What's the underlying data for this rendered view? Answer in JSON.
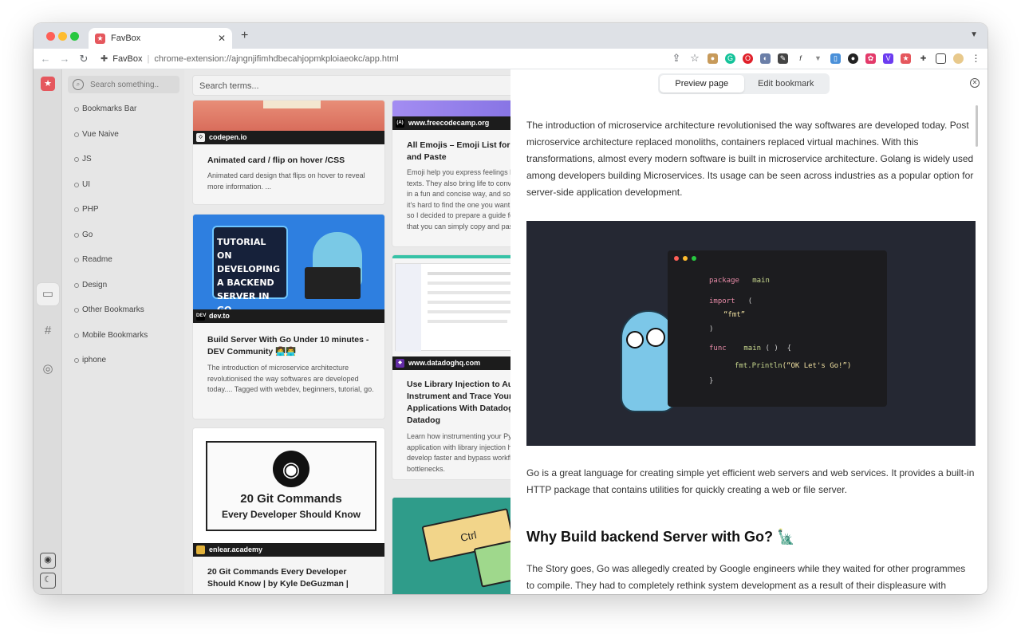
{
  "browser": {
    "tab_title": "FavBox",
    "new_tab": "+",
    "site_name": "FavBox",
    "url": "chrome-extension://ajngnjifimhdbecahjopmkploiaeokc/app.html"
  },
  "sidebar": {
    "search_placeholder": "Search something..",
    "folders": [
      "Bookmarks Bar",
      "Vue Naive",
      "JS",
      "UI",
      "PHP",
      "Go",
      "Readme",
      "Design",
      "Other Bookmarks",
      "Mobile Bookmarks",
      "iphone"
    ]
  },
  "main": {
    "search_placeholder": "Search terms...",
    "cards": [
      {
        "source": "codepen.io",
        "title": "Animated card / flip on hover /CSS",
        "desc": "Animated card design that flips on hover to reveal more information. ..."
      },
      {
        "source": "dev.to",
        "title": "Build Server With Go Under 10 minutes - DEV Community 👩‍💻👨‍💻",
        "desc": "The introduction of microservice architecture revolutionised the way softwares are developed today.... Tagged with webdev, beginners, tutorial, go.",
        "thumb_text": "TUTORIAL ON DEVELOPING A BACKEND SERVER IN GO"
      },
      {
        "source": "enlear.academy",
        "title": "20 Git Commands Every Developer Should Know | by Kyle DeGuzman |",
        "thumb_line1": "20 Git Commands",
        "thumb_line2": "Every Developer Should Know"
      },
      {
        "source": "www.freecodecamp.org",
        "title": "All Emojis – Emoji List for Copy and Paste",
        "desc": "Emoji help you express feelings beyond texts. They also bring life to conversations in a fun and concise way, and sometimes it's hard to find the one you want to use, so I decided to prepare a guide for them that you can simply copy and paste."
      },
      {
        "source": "www.datadoghq.com",
        "title": "Use Library Injection to Auto-Instrument and Trace Your Applications With Datadog | Datadog",
        "desc": "Learn how instrumenting your Python application with library injection helps you develop faster and bypass workflow bottlenecks."
      },
      {
        "source": "",
        "thumb_text": "Ctrl"
      }
    ]
  },
  "preview": {
    "tabs": [
      "Preview page",
      "Edit bookmark"
    ],
    "intro": "The introduction of microservice architecture revolutionised the way softwares are developed today. Post microservice architecture replaced monoliths, containers replaced virtual machines. With this transformations, almost every modern software is built in microservice architecture. Golang is widely used among developers building Microservices. Its usage can be seen across industries as a popular option for server-side application development.",
    "code": {
      "l1a": "package",
      "l1b": "main",
      "l2a": "import",
      "l2b": "(",
      "l3": "“fmt”",
      "l4": ")",
      "l5a": "func",
      "l5b": "main",
      "l5c": "( )",
      "l5d": "{",
      "l6a": "fmt.Println",
      "l6b": "(“OK Let's Go!”)",
      "l7": "}"
    },
    "para2": "Go is a great language for creating simple yet efficient web servers and web services. It provides a built-in HTTP package that contains utilities for quickly creating a web or file server.",
    "heading": "Why Build backend Server with Go? 🗽",
    "para3": "The Story goes, Go was allegedly created by Google engineers while they waited for other programmes to compile. They had to completely rethink system development as a result of their displeasure with"
  },
  "colors": {
    "brand": "#e5575d",
    "hero_bg": "#252833"
  }
}
